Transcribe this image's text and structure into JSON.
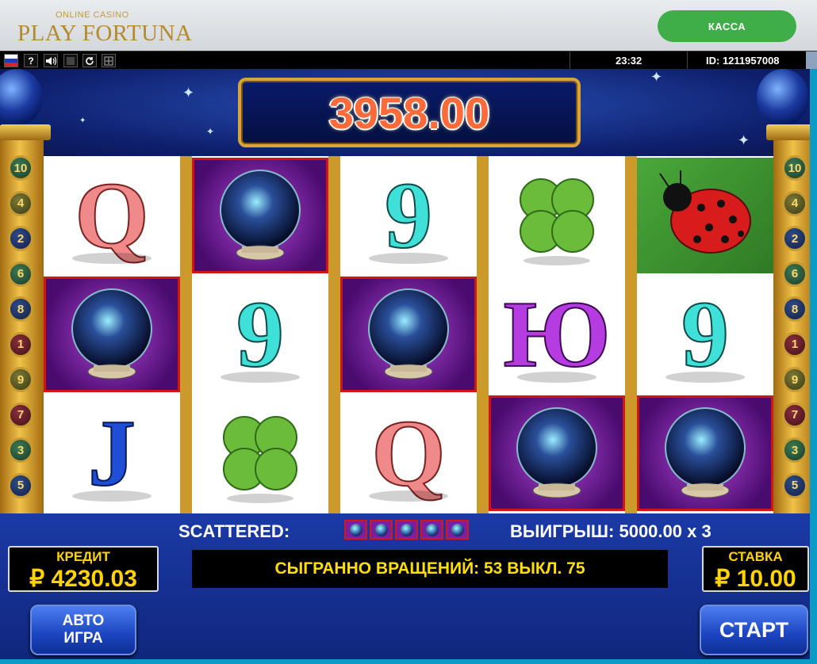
{
  "header": {
    "logo_small": "ONLINE CASINO",
    "logo_big": "PLAY FORTUNA",
    "cashier_button": "КАССА"
  },
  "toolbar": {
    "flag": "russian-flag-icon",
    "help": "?",
    "clock": "23:32",
    "id_text": "ID: 1211957008"
  },
  "game": {
    "win_display": "3958.00",
    "paylines_left": [
      "10",
      "4",
      "2",
      "6",
      "8",
      "1",
      "9",
      "7",
      "3",
      "5"
    ],
    "paylines_right": [
      "10",
      "4",
      "2",
      "6",
      "8",
      "1",
      "9",
      "7",
      "3",
      "5"
    ],
    "reels": [
      [
        "Q",
        "crystal-ball",
        "J"
      ],
      [
        "crystal-ball",
        "9",
        "clover"
      ],
      [
        "9",
        "crystal-ball",
        "Q"
      ],
      [
        "clover",
        "Ю",
        "crystal-ball"
      ],
      [
        "ladybug",
        "9",
        "crystal-ball"
      ]
    ],
    "colors": {
      "Q": "#f08a8a",
      "9": "#3fe0d8",
      "J": "#1f4fd6",
      "Ю": "#b53ce0",
      "highlight": "#d11414",
      "accent": "#ffd400"
    }
  },
  "bottom": {
    "scattered_label": "SCATTERED:",
    "scatter_count": 5,
    "win_label": "ВЫИГРЫШ: 5000.00 x 3",
    "credit_label": "КРЕДИТ",
    "credit_value": "₽ 4230.03",
    "status_text": "СЫГРАННО ВРАЩЕНИЙ: 53 ВЫКЛ. 75",
    "bet_label": "СТАВКА",
    "bet_value": "₽ 10.00",
    "auto_line1": "АВТО",
    "auto_line2": "ИГРА",
    "start_label": "СТАРТ"
  }
}
